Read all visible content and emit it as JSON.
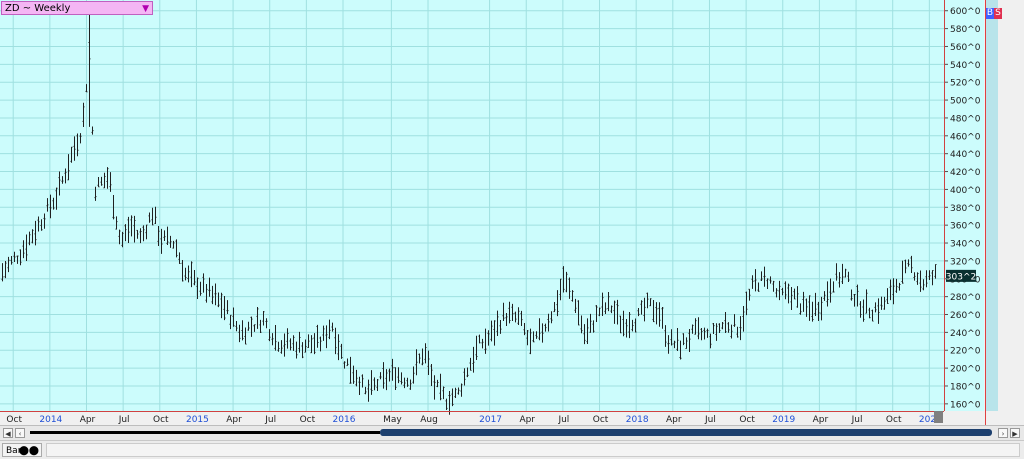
{
  "window": {
    "symbol_title": "ZD ~ Weekly"
  },
  "tags": {
    "buy": "B",
    "sell": "S",
    "buy_color": "#4060ff",
    "sell_color": "#e03050"
  },
  "status_bar": {
    "mode_label": "Bars"
  },
  "colors": {
    "background": "#ccfcfc",
    "grid": "#9fe0e0",
    "bars": "#202020",
    "axis_line": "#d04040",
    "year_label": "#1f4fd6",
    "month_label": "#202020",
    "last_price_box": "#0a3030"
  },
  "chart_data": {
    "type": "ohlc",
    "y_labels": [
      "160^0",
      "180^0",
      "200^0",
      "220^0",
      "240^0",
      "260^0",
      "280^0",
      "300^0",
      "320^0",
      "340^0",
      "360^0",
      "380^0",
      "400^0",
      "420^0",
      "440^0",
      "460^0",
      "480^0",
      "500^0",
      "520^0",
      "540^0",
      "560^0",
      "580^0",
      "600^0"
    ],
    "y_tick_values": [
      160,
      180,
      200,
      220,
      240,
      260,
      280,
      300,
      320,
      340,
      360,
      380,
      400,
      420,
      440,
      460,
      480,
      500,
      520,
      540,
      560,
      580,
      600
    ],
    "ylim": [
      152,
      612
    ],
    "last_price_label": "303^2",
    "last_price": 303.25,
    "x_labels": [
      {
        "t": "Oct",
        "v": 2013.75,
        "year": false
      },
      {
        "t": "2014",
        "v": 2014.0,
        "year": true
      },
      {
        "t": "Apr",
        "v": 2014.25,
        "year": false
      },
      {
        "t": "Jul",
        "v": 2014.5,
        "year": false
      },
      {
        "t": "Oct",
        "v": 2014.75,
        "year": false
      },
      {
        "t": "2015",
        "v": 2015.0,
        "year": true
      },
      {
        "t": "Apr",
        "v": 2015.25,
        "year": false
      },
      {
        "t": "Jul",
        "v": 2015.5,
        "year": false
      },
      {
        "t": "Oct",
        "v": 2015.75,
        "year": false
      },
      {
        "t": "2016",
        "v": 2016.0,
        "year": true
      },
      {
        "t": "May",
        "v": 2016.33,
        "year": false
      },
      {
        "t": "Aug",
        "v": 2016.58,
        "year": false
      },
      {
        "t": "2017",
        "v": 2017.0,
        "year": true
      },
      {
        "t": "Apr",
        "v": 2017.25,
        "year": false
      },
      {
        "t": "Jul",
        "v": 2017.5,
        "year": false
      },
      {
        "t": "Oct",
        "v": 2017.75,
        "year": false
      },
      {
        "t": "2018",
        "v": 2018.0,
        "year": true
      },
      {
        "t": "Apr",
        "v": 2018.25,
        "year": false
      },
      {
        "t": "Jul",
        "v": 2018.5,
        "year": false
      },
      {
        "t": "Oct",
        "v": 2018.75,
        "year": false
      },
      {
        "t": "2019",
        "v": 2019.0,
        "year": true
      },
      {
        "t": "Apr",
        "v": 2019.25,
        "year": false
      },
      {
        "t": "Jul",
        "v": 2019.5,
        "year": false
      },
      {
        "t": "Oct",
        "v": 2019.75,
        "year": false
      },
      {
        "t": "2020",
        "v": 2020.0,
        "year": true
      }
    ],
    "xlim": [
      2013.66,
      2020.1
    ],
    "price_path": [
      [
        2013.66,
        305
      ],
      [
        2013.8,
        330
      ],
      [
        2013.92,
        360
      ],
      [
        2014.05,
        395
      ],
      [
        2014.15,
        440
      ],
      [
        2014.22,
        470
      ],
      [
        2014.27,
        560
      ],
      [
        2014.3,
        400
      ],
      [
        2014.4,
        415
      ],
      [
        2014.48,
        340
      ],
      [
        2014.55,
        360
      ],
      [
        2014.62,
        345
      ],
      [
        2014.7,
        375
      ],
      [
        2014.75,
        345
      ],
      [
        2014.85,
        340
      ],
      [
        2014.92,
        305
      ],
      [
        2015.0,
        295
      ],
      [
        2015.08,
        285
      ],
      [
        2015.18,
        270
      ],
      [
        2015.3,
        240
      ],
      [
        2015.45,
        255
      ],
      [
        2015.55,
        230
      ],
      [
        2015.7,
        225
      ],
      [
        2015.85,
        230
      ],
      [
        2015.92,
        250
      ],
      [
        2016.0,
        210
      ],
      [
        2016.1,
        190
      ],
      [
        2016.15,
        172
      ],
      [
        2016.25,
        185
      ],
      [
        2016.35,
        195
      ],
      [
        2016.45,
        185
      ],
      [
        2016.55,
        220
      ],
      [
        2016.62,
        180
      ],
      [
        2016.7,
        165
      ],
      [
        2016.78,
        170
      ],
      [
        2016.85,
        200
      ],
      [
        2016.92,
        225
      ],
      [
        2017.0,
        235
      ],
      [
        2017.1,
        260
      ],
      [
        2017.2,
        255
      ],
      [
        2017.28,
        225
      ],
      [
        2017.35,
        240
      ],
      [
        2017.45,
        270
      ],
      [
        2017.5,
        300
      ],
      [
        2017.58,
        275
      ],
      [
        2017.65,
        235
      ],
      [
        2017.75,
        265
      ],
      [
        2017.82,
        270
      ],
      [
        2017.9,
        250
      ],
      [
        2018.0,
        255
      ],
      [
        2018.08,
        270
      ],
      [
        2018.15,
        265
      ],
      [
        2018.22,
        230
      ],
      [
        2018.3,
        225
      ],
      [
        2018.4,
        240
      ],
      [
        2018.5,
        235
      ],
      [
        2018.6,
        250
      ],
      [
        2018.7,
        245
      ],
      [
        2018.8,
        295
      ],
      [
        2018.9,
        300
      ],
      [
        2018.97,
        280
      ],
      [
        2019.05,
        285
      ],
      [
        2019.15,
        265
      ],
      [
        2019.25,
        270
      ],
      [
        2019.35,
        300
      ],
      [
        2019.42,
        305
      ],
      [
        2019.5,
        275
      ],
      [
        2019.6,
        265
      ],
      [
        2019.68,
        270
      ],
      [
        2019.78,
        295
      ],
      [
        2019.87,
        315
      ],
      [
        2019.95,
        295
      ],
      [
        2020.0,
        300
      ],
      [
        2020.05,
        305
      ]
    ]
  }
}
